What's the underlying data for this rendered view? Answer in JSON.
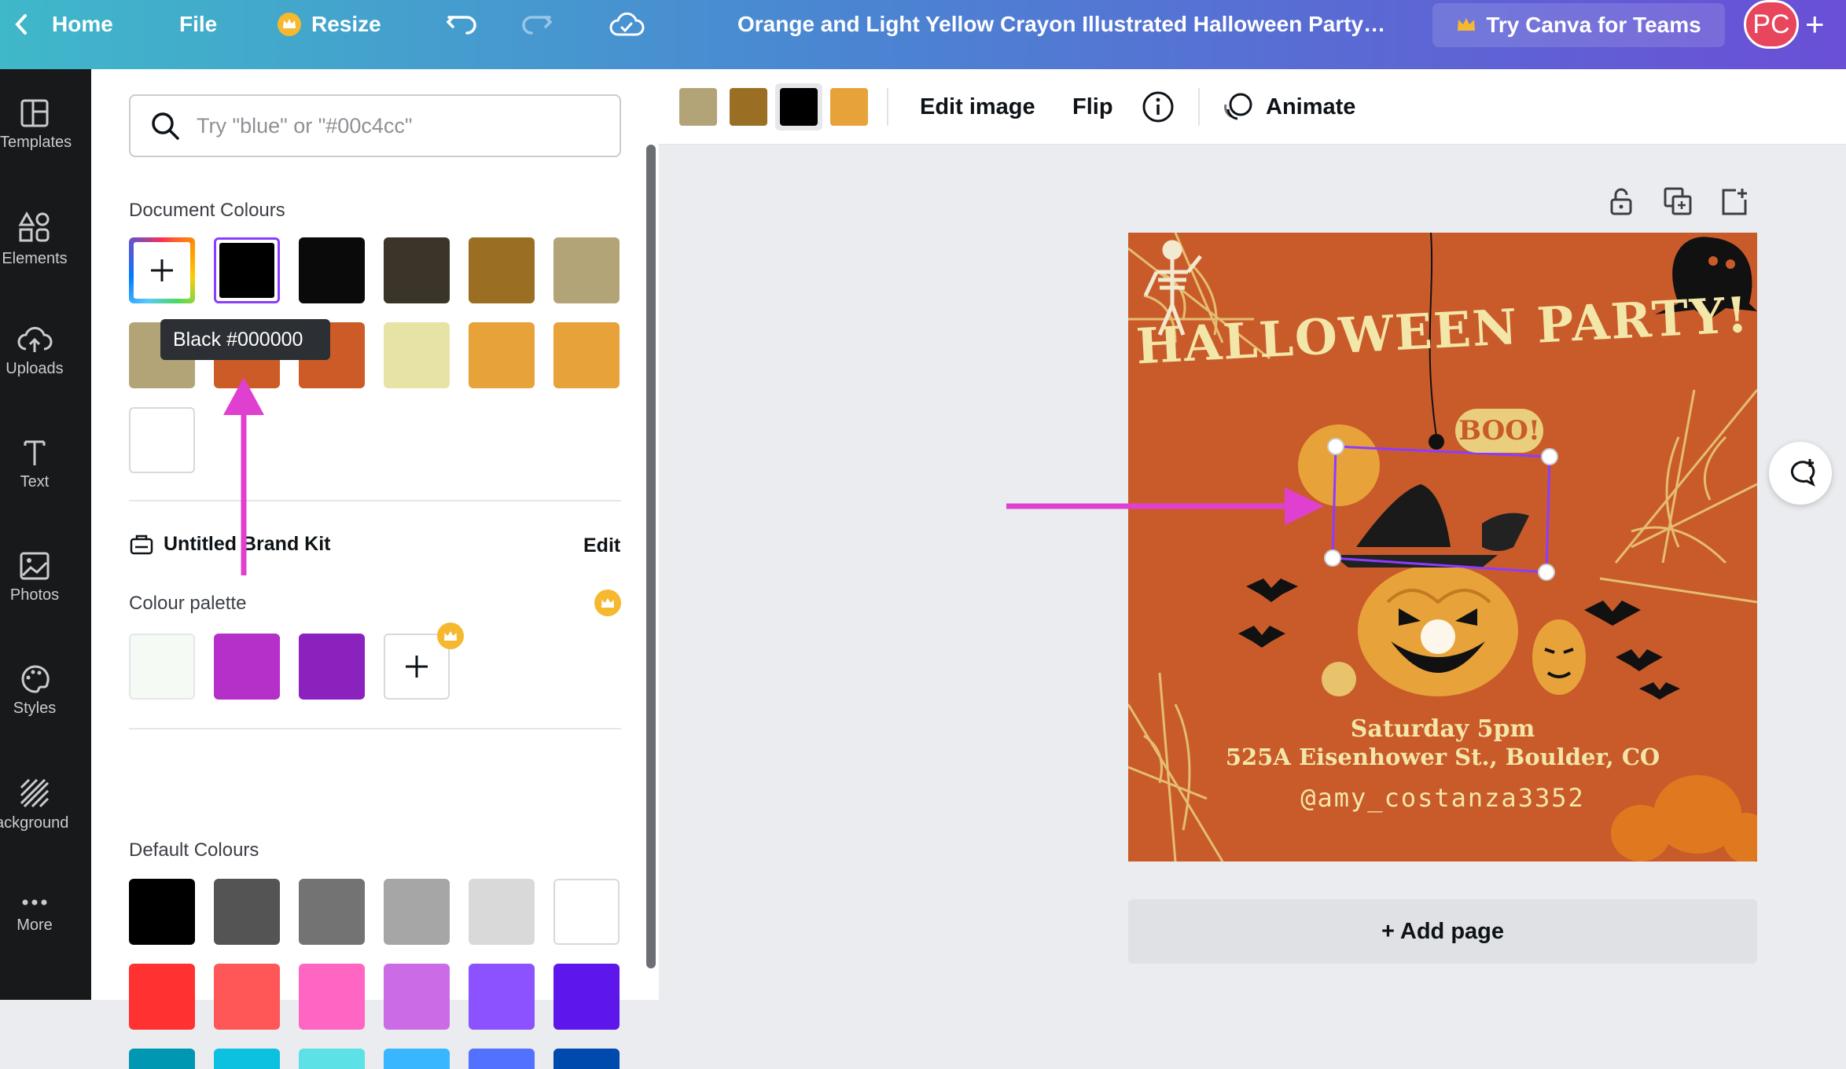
{
  "topbar": {
    "home": "Home",
    "file": "File",
    "resize": "Resize",
    "title": "Orange and Light Yellow Crayon Illustrated Halloween Party…",
    "try_teams": "Try Canva for Teams",
    "avatar": "PC",
    "plus": "+"
  },
  "rail": [
    {
      "label": "Templates",
      "icon": "templates-icon"
    },
    {
      "label": "Elements",
      "icon": "elements-icon"
    },
    {
      "label": "Uploads",
      "icon": "uploads-icon"
    },
    {
      "label": "Text",
      "icon": "text-icon"
    },
    {
      "label": "Photos",
      "icon": "photos-icon"
    },
    {
      "label": "Styles",
      "icon": "styles-icon"
    },
    {
      "label": "Background",
      "icon": "background-icon"
    },
    {
      "label": "More",
      "icon": "more-icon"
    }
  ],
  "panel": {
    "search_placeholder": "Try \"blue\" or \"#00c4cc\"",
    "document_colours_label": "Document Colours",
    "document_colours": [
      "#000000",
      "#0a0a0a",
      "#3b3428",
      "#9a6f24",
      "#b3a478",
      "#b3a478",
      "#cc5b27",
      "#cc5b27",
      "#e6e3a4",
      "#e8a23a",
      "#e8a23a",
      "#ffffff"
    ],
    "tooltip": "Black #000000",
    "brand_kit_label": "Untitled Brand Kit",
    "edit_label": "Edit",
    "colour_palette_label": "Colour palette",
    "palette_colours": [
      "#f5fbf4",
      "#b530c8",
      "#8b22be"
    ],
    "default_colours_label": "Default Colours",
    "default_colours": [
      "#000000",
      "#545454",
      "#737373",
      "#a6a6a6",
      "#d9d9d9",
      "#ffffff",
      "#ff3131",
      "#ff5757",
      "#ff66c4",
      "#cb6ce6",
      "#8c52ff",
      "#5e17eb",
      "#0097b2",
      "#0cc0df",
      "#5ce1e6",
      "#38b6ff",
      "#5271ff",
      "#004aad"
    ]
  },
  "ctxbar": {
    "swatches": [
      "#b3a478",
      "#9a6f24",
      "#000000",
      "#e8a23a"
    ],
    "edit_image": "Edit image",
    "flip": "Flip",
    "animate": "Animate"
  },
  "design": {
    "headline": "HALLOWEEN PARTY!",
    "boo": "BOO!",
    "line1": "Saturday 5pm",
    "line2": "525A Eisenhower St., Boulder, CO",
    "handle": "@amy_costanza3352",
    "bg_color": "#c95b2a"
  },
  "add_page": "+ Add page",
  "accent": "#e040d0"
}
